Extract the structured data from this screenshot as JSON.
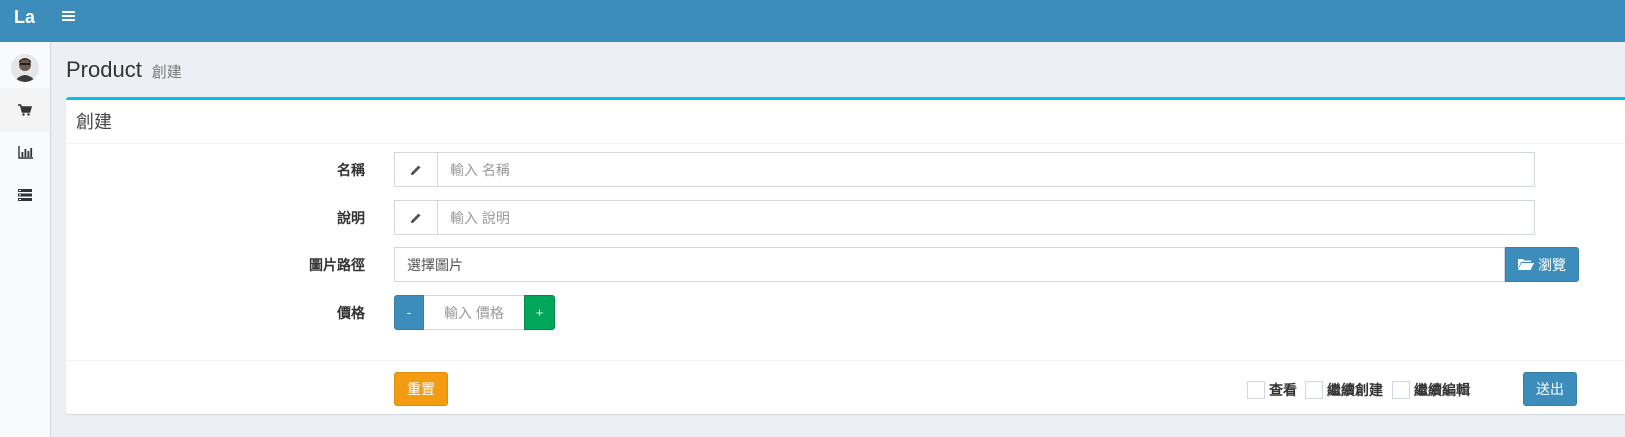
{
  "header": {
    "logo": "La",
    "menu_icon": "hamburger-icon"
  },
  "sidebar": {
    "items": [
      {
        "icon": "cart-icon"
      },
      {
        "icon": "bar-chart-icon"
      },
      {
        "icon": "list-table-icon"
      }
    ]
  },
  "page": {
    "title": "Product",
    "subtitle": "創建"
  },
  "form": {
    "box_title": "創建",
    "fields": {
      "name": {
        "label": "名稱",
        "placeholder": "輸入 名稱",
        "icon": "pencil-icon"
      },
      "description": {
        "label": "說明",
        "placeholder": "輸入 說明",
        "icon": "pencil-icon"
      },
      "image_path": {
        "label": "圖片路徑",
        "placeholder": "選擇圖片",
        "button": "瀏覽",
        "button_icon": "folder-open-icon"
      },
      "price": {
        "label": "價格",
        "placeholder": "輸入 價格",
        "minus": "-",
        "plus": "+"
      }
    },
    "footer": {
      "reset": "重置",
      "checks": [
        "查看",
        "繼續創建",
        "繼續編輯"
      ],
      "submit": "送出"
    }
  },
  "colors": {
    "primary": "#3c8dbc",
    "success": "#00a65a",
    "warning": "#f39c12",
    "info": "#00c0ef",
    "background": "#ecf0f5"
  }
}
